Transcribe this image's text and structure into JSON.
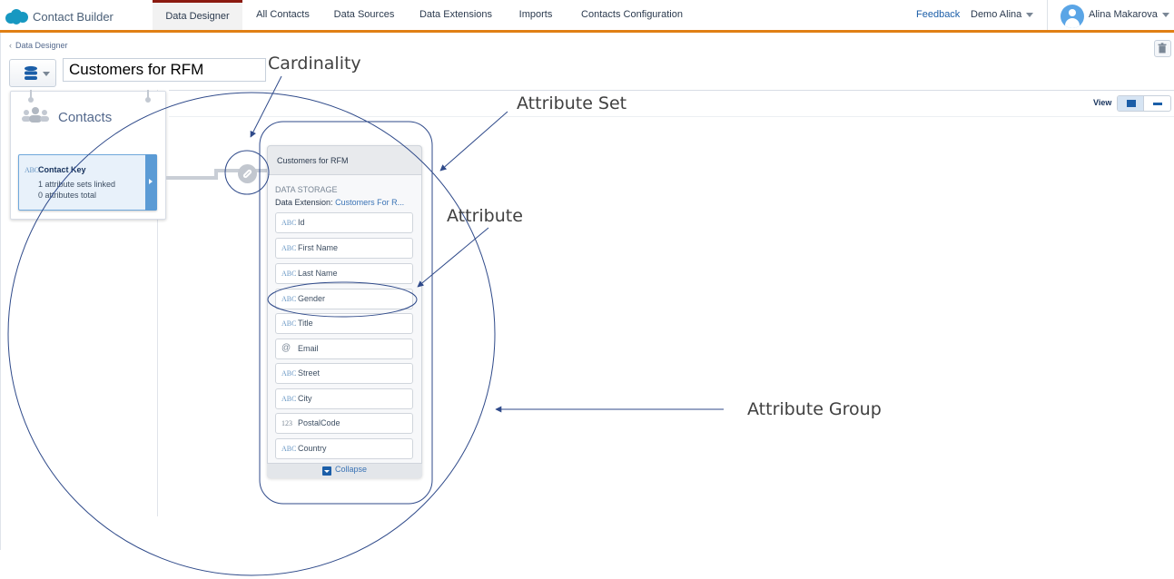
{
  "app": {
    "name": "Contact Builder"
  },
  "nav": {
    "tabs": [
      {
        "label": "Data Designer"
      },
      {
        "label": "All Contacts"
      },
      {
        "label": "Data Sources"
      },
      {
        "label": "Data Extensions"
      },
      {
        "label": "Imports"
      },
      {
        "label": "Contacts Configuration"
      }
    ],
    "feedback": "Feedback",
    "org": "Demo Alina",
    "user": "Alina Makarova"
  },
  "header": {
    "breadcrumb": "Data Designer",
    "title_value": "Customers for RFM",
    "view_label": "View"
  },
  "contacts": {
    "title": "Contacts",
    "key": {
      "type": "ABC",
      "label": "Contact Key",
      "line1": "1 attribute sets linked",
      "line2": "0 attributes total"
    }
  },
  "attribute_set": {
    "title": "Customers for RFM",
    "storage_label": "DATA STORAGE",
    "storage_prefix": "Data Extension:",
    "storage_value": "Customers For R...",
    "attributes": [
      {
        "type": "ABC",
        "name": "Id"
      },
      {
        "type": "ABC",
        "name": "First Name"
      },
      {
        "type": "ABC",
        "name": "Last Name"
      },
      {
        "type": "ABC",
        "name": "Gender"
      },
      {
        "type": "ABC",
        "name": "Title"
      },
      {
        "type": "@",
        "name": "Email"
      },
      {
        "type": "ABC",
        "name": "Street"
      },
      {
        "type": "ABC",
        "name": "City"
      },
      {
        "type": "123",
        "name": "PostalCode"
      },
      {
        "type": "ABC",
        "name": "Country"
      }
    ],
    "collapse": "Collapse"
  },
  "annotations": {
    "cardinality": "Cardinality",
    "attribute_set": "Attribute Set",
    "attribute": "Attribute",
    "attribute_group": "Attribute Group"
  },
  "colors": {
    "accent_bar": "#e07f14",
    "active_tab_top": "#8b1a10",
    "link_blue": "#1b5ea8",
    "annotation_stroke": "#2f4a8a"
  }
}
